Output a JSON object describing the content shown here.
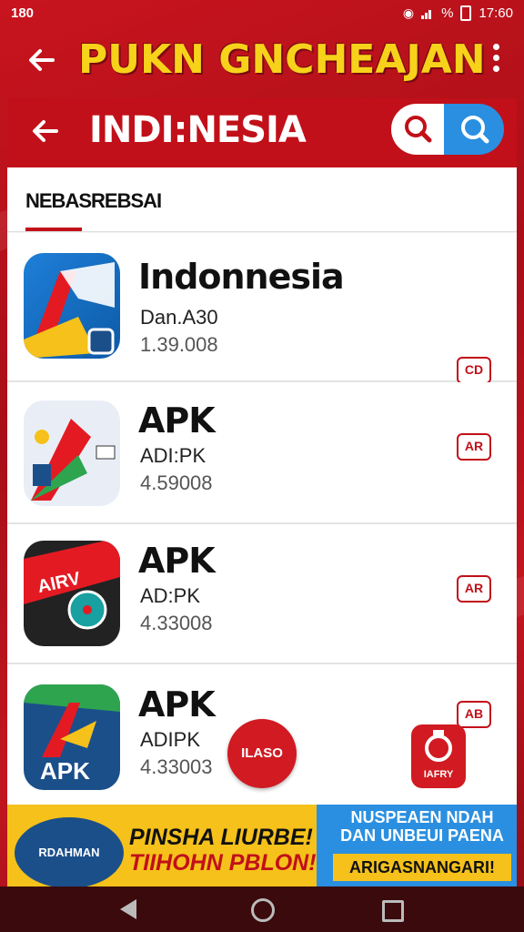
{
  "status_bar": {
    "left_text": "180",
    "right_text": "%",
    "time": "17:60"
  },
  "app_bar": {
    "back_icon": "arrow-left-icon",
    "title": "PUKN GNCHEAJAN",
    "menu_icon": "more-vert-icon"
  },
  "search_bar": {
    "back_icon": "arrow-left-icon",
    "title": "INDI:NESIA",
    "search_icon": "search-icon",
    "lens_icon": "search-icon"
  },
  "section": {
    "label": "NEBASREBSAI"
  },
  "apps": [
    {
      "name": "Indonnesia",
      "sub": "Dan.A30",
      "num": "1.39.008",
      "tag": "CD"
    },
    {
      "name": "APK",
      "sub": "ADI:PK",
      "num": "4.59008",
      "tag": "AR"
    },
    {
      "name": "APK",
      "sub": "AD:PK",
      "num": "4.33008",
      "tag": "AR"
    },
    {
      "name": "APK",
      "sub": "ADIPK",
      "num": "4.33003",
      "tag": "AB"
    }
  ],
  "app_icon_texts": {
    "fourth": "APK",
    "second_banner": "AIRV"
  },
  "floating": {
    "label": "ILASO",
    "small_app_label": "IAFRY"
  },
  "banner": {
    "badge": "RDAHMAN",
    "line1": "PINSHA LIURBE!",
    "line2": "TIIHOHN PBLON!",
    "right_top": "NUSPEAEN NDAH DAN UNBEUI PAENA",
    "right_bottom": "ARIGASNANGARI!"
  },
  "nav": {
    "back": "back-icon",
    "home": "home-icon",
    "recent": "recent-apps-icon"
  },
  "colors": {
    "primary": "#c11019",
    "yellow": "#f5c11a",
    "blue": "#2a8fe0"
  }
}
